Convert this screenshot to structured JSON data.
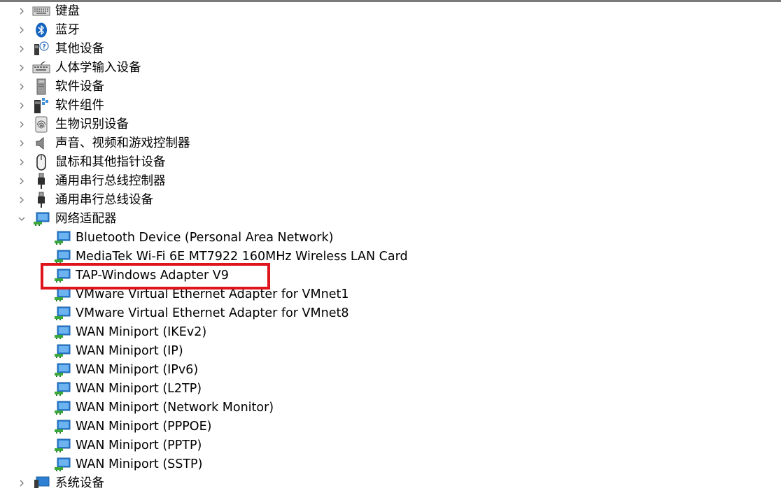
{
  "colors": {
    "highlight": "#e0141b",
    "network_icon": "#2c7fd2",
    "network_cable": "#3aa83a",
    "chevron": "#7a7a7a"
  },
  "tree": {
    "categories": [
      {
        "label": "键盘",
        "icon": "keyboard-icon",
        "expanded": false
      },
      {
        "label": "蓝牙",
        "icon": "bluetooth-icon",
        "expanded": false
      },
      {
        "label": "其他设备",
        "icon": "unknown-device-icon",
        "expanded": false
      },
      {
        "label": "人体学输入设备",
        "icon": "hid-keyboard-icon",
        "expanded": false
      },
      {
        "label": "软件设备",
        "icon": "software-device-icon",
        "expanded": false
      },
      {
        "label": "软件组件",
        "icon": "software-component-icon",
        "expanded": false
      },
      {
        "label": "生物识别设备",
        "icon": "fingerprint-icon",
        "expanded": false
      },
      {
        "label": "声音、视频和游戏控制器",
        "icon": "speaker-icon",
        "expanded": false
      },
      {
        "label": "鼠标和其他指针设备",
        "icon": "mouse-icon",
        "expanded": false
      },
      {
        "label": "通用串行总线控制器",
        "icon": "usb-icon",
        "expanded": false
      },
      {
        "label": "通用串行总线设备",
        "icon": "usb-icon",
        "expanded": false
      },
      {
        "label": "网络适配器",
        "icon": "network-adapter-icon",
        "expanded": true
      }
    ],
    "network_adapters": [
      "Bluetooth Device (Personal Area Network)",
      "MediaTek Wi-Fi 6E MT7922 160MHz Wireless LAN Card",
      "TAP-Windows Adapter V9",
      "VMware Virtual Ethernet Adapter for VMnet1",
      "VMware Virtual Ethernet Adapter for VMnet8",
      "WAN Miniport (IKEv2)",
      "WAN Miniport (IP)",
      "WAN Miniport (IPv6)",
      "WAN Miniport (L2TP)",
      "WAN Miniport (Network Monitor)",
      "WAN Miniport (PPPOE)",
      "WAN Miniport (PPTP)",
      "WAN Miniport (SSTP)"
    ],
    "next_category": {
      "label": "系统设备",
      "icon": "system-device-icon",
      "expanded": false
    }
  }
}
